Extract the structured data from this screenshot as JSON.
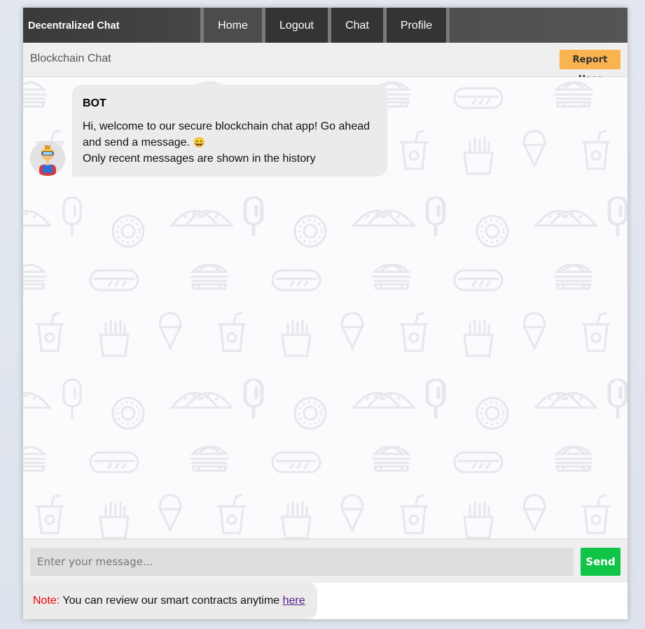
{
  "navbar": {
    "brand": "Decentralized Chat",
    "items": [
      {
        "label": "Home"
      },
      {
        "label": "Logout"
      },
      {
        "label": "Chat"
      },
      {
        "label": "Profile"
      }
    ]
  },
  "subheader": {
    "title": "Blockchain Chat",
    "report_label": "Report User"
  },
  "messages": [
    {
      "sender": "BOT",
      "line1": "Hi, welcome to our secure blockchain chat app! Go ahead",
      "line2": "and send a message.",
      "emoji": "😄",
      "line3": "Only recent messages are shown in the history"
    }
  ],
  "composer": {
    "placeholder": "Enter your message...",
    "value": "",
    "send_label": "Send"
  },
  "note": {
    "label": "Note:",
    "text": "You can review our smart contracts anytime",
    "link_label": "here"
  },
  "colors": {
    "accent_send": "#0fc446",
    "accent_report": "#f9b34f",
    "note_label": "#ee0000"
  },
  "icons": {
    "avatar": "robot-avatar-icon",
    "background": "food-pattern-icons"
  }
}
